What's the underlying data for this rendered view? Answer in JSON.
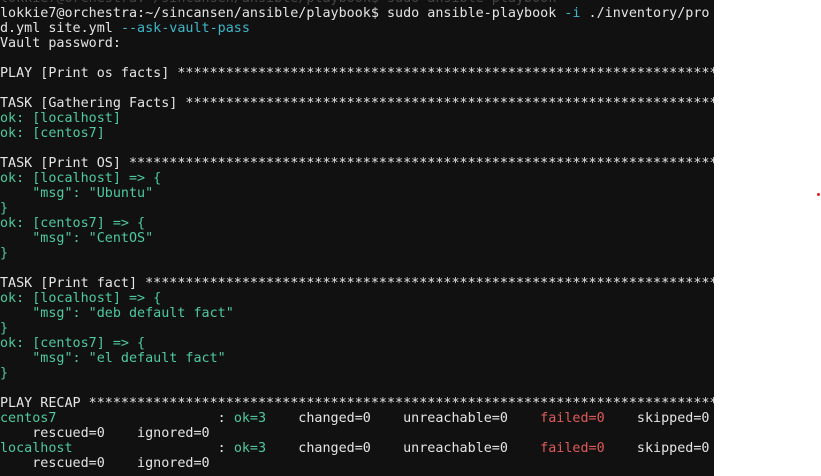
{
  "terminal": {
    "lines": [
      [
        {
          "t": "lokkie7@orchestra:~/sincansen/ansible/playbook$ sudo ansible-playbook",
          "c": "faint"
        }
      ],
      [
        {
          "t": "lokkie7@orchestra:~/sincansen/ansible/playbook$ sudo ansible-playbook "
        },
        {
          "t": "-i",
          "c": "c"
        },
        {
          "t": " ./inventory/pro"
        }
      ],
      [
        {
          "t": "d.yml site.yml "
        },
        {
          "t": "--ask-vault-pass",
          "c": "c"
        }
      ],
      [
        {
          "t": "Vault password:"
        }
      ],
      [],
      [
        {
          "t": "PLAY [Print os facts] ***********************************************************************"
        }
      ],
      [],
      [
        {
          "t": "TASK [Gathering Facts] **********************************************************************"
        }
      ],
      [
        {
          "t": "ok: [localhost]",
          "c": "g"
        }
      ],
      [
        {
          "t": "ok: [centos7]",
          "c": "g"
        }
      ],
      [],
      [
        {
          "t": "TASK [Print OS] *****************************************************************************"
        }
      ],
      [
        {
          "t": "ok: [localhost] => {",
          "c": "g"
        }
      ],
      [
        {
          "t": "    \"msg\": \"Ubuntu\"",
          "c": "g"
        }
      ],
      [
        {
          "t": "}",
          "c": "g"
        }
      ],
      [
        {
          "t": "ok: [centos7] => {",
          "c": "g"
        }
      ],
      [
        {
          "t": "    \"msg\": \"CentOS\"",
          "c": "g"
        }
      ],
      [
        {
          "t": "}",
          "c": "g"
        }
      ],
      [],
      [
        {
          "t": "TASK [Print fact] ***************************************************************************"
        }
      ],
      [
        {
          "t": "ok: [localhost] => {",
          "c": "g"
        }
      ],
      [
        {
          "t": "    \"msg\": \"deb default fact\"",
          "c": "g"
        }
      ],
      [
        {
          "t": "}",
          "c": "g"
        }
      ],
      [
        {
          "t": "ok: [centos7] => {",
          "c": "g"
        }
      ],
      [
        {
          "t": "    \"msg\": \"el default fact\"",
          "c": "g"
        }
      ],
      [
        {
          "t": "}",
          "c": "g"
        }
      ],
      [],
      [
        {
          "t": "PLAY RECAP **********************************************************************************"
        }
      ],
      [
        {
          "t": "centos7",
          "c": "g"
        },
        {
          "t": "                    : "
        },
        {
          "t": "ok=3",
          "c": "g"
        },
        {
          "t": "    changed=0    unreachable=0    "
        },
        {
          "t": "failed=0",
          "c": "r"
        },
        {
          "t": "    skipped=0"
        }
      ],
      [
        {
          "t": "    rescued=0    ignored=0"
        }
      ],
      [
        {
          "t": "localhost",
          "c": "g"
        },
        {
          "t": "                  : "
        },
        {
          "t": "ok=3",
          "c": "g"
        },
        {
          "t": "    changed=0    unreachable=0    "
        },
        {
          "t": "failed=0",
          "c": "r"
        },
        {
          "t": "    skipped=0"
        }
      ],
      [
        {
          "t": "    rescued=0    ignored=0"
        }
      ]
    ]
  },
  "colors": {
    "background": "#111111",
    "text": "#e5e5e5",
    "ok_green": "#4ec9a0",
    "option_cyan": "#3fb6c9",
    "failed_red": "#e05a5a"
  }
}
